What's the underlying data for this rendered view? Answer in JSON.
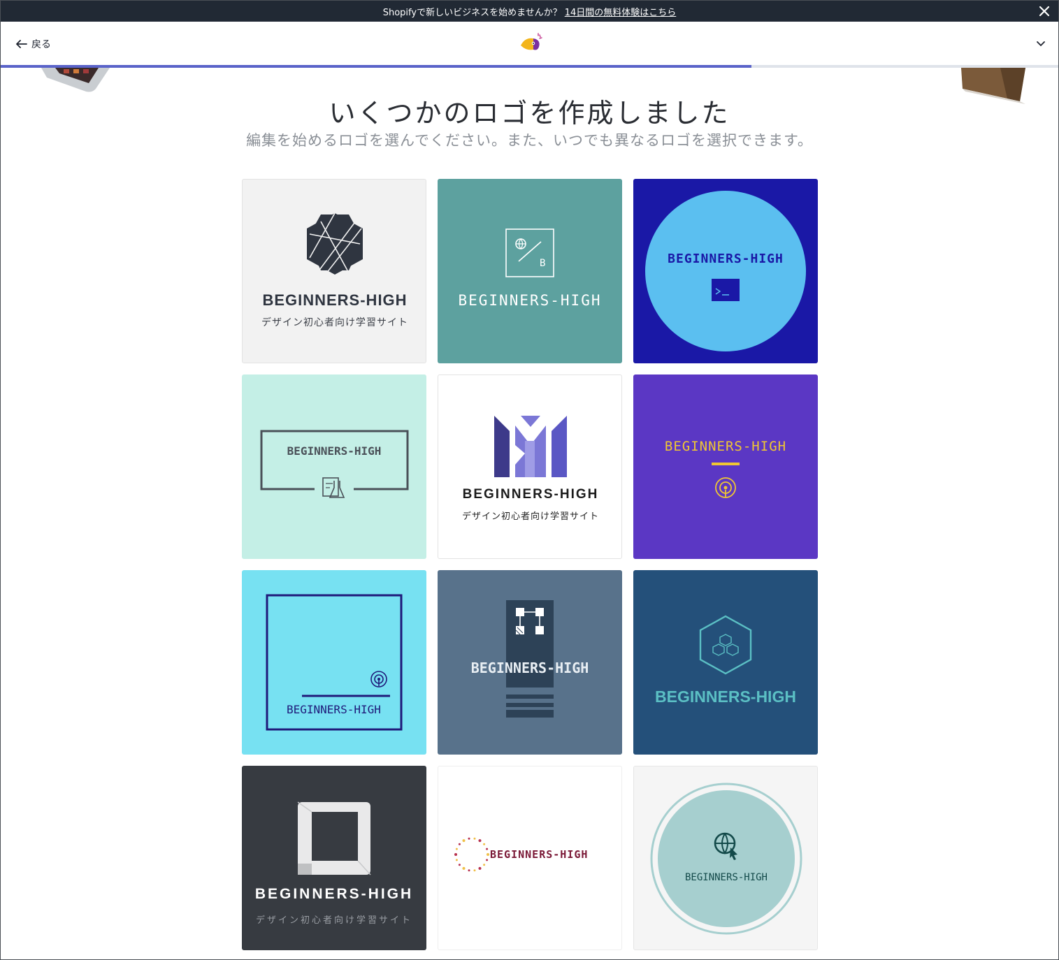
{
  "promo": {
    "text": "Shopifyで新しいビジネスを始めませんか？",
    "link": "14日間の無料体験はこちら"
  },
  "topbar": {
    "back_label": "戻る",
    "progress_percent": 71
  },
  "heading": {
    "title": "いくつかのロゴを作成しました",
    "subtitle": "編集を始めるロゴを選んでください。また、いつでも異なるロゴを選択できます。"
  },
  "logos": [
    {
      "name": "BEGINNERS-HIGH",
      "tagline": "デザイン初心者向け学習サイト",
      "bg": "#f2f2f2",
      "icon": "hexagon-icon"
    },
    {
      "name": "BEGINNERS-HIGH",
      "monogram": "B",
      "bg": "#5da19f",
      "icon": "globe-icon"
    },
    {
      "name": "BEGINNERS-HIGH",
      "bg": "#1a18a6",
      "icon": "terminal-icon"
    },
    {
      "name": "BEGINNERS-HIGH",
      "bg": "#c4efe6",
      "icon": "lab-icon"
    },
    {
      "name": "BEGINNERS-HIGH",
      "tagline": "デザイン初心者向け学習サイト",
      "bg": "#ffffff",
      "icon": "m-bars-icon"
    },
    {
      "name": "BEGINNERS-HIGH",
      "bg": "#5b37c4",
      "icon": "broadcast-icon"
    },
    {
      "name": "BEGINNERS-HIGH",
      "bg": "#77e1f2",
      "icon": "broadcast-icon"
    },
    {
      "name": "BEGINNERS-HIGH",
      "bg": "#58728b",
      "icon": "nodes-icon"
    },
    {
      "name": "BEGINNERS-HIGH",
      "bg": "#24507a",
      "icon": "cubes-icon"
    },
    {
      "name": "BEGINNERS-HIGH",
      "tagline": "デザイン初心者向け学習サイト",
      "bg": "#373b41",
      "icon": "square-frame-icon"
    },
    {
      "name": "BEGINNERS-HIGH",
      "bg": "#ffffff",
      "icon": "dotted-circle-icon"
    },
    {
      "name": "BEGINNERS-HIGH",
      "bg": "#f5f5f5",
      "icon": "globe-cursor-icon"
    }
  ]
}
